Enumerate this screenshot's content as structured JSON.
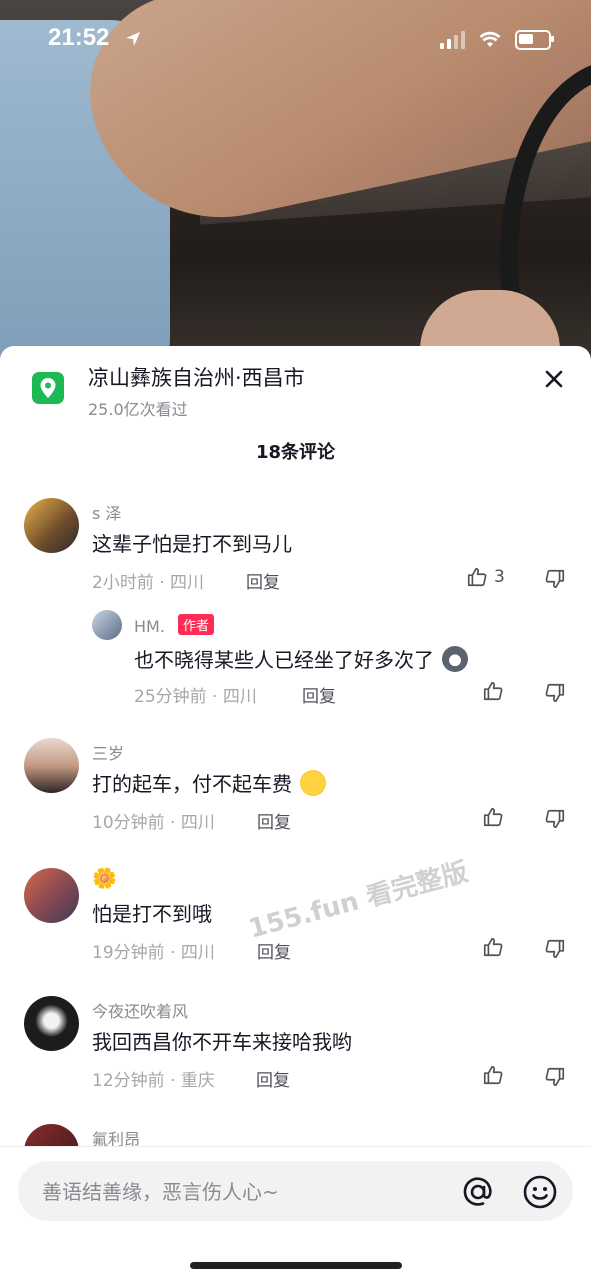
{
  "status_bar": {
    "time": "21:52"
  },
  "location": {
    "title": "凉山彝族自治州·西昌市",
    "views": "25.0亿次看过"
  },
  "comments_header": {
    "count_label": "18条评论"
  },
  "comments": [
    {
      "name": "s 泽",
      "text": "这辈子怕是打不到马儿",
      "meta": "2小时前 · 四川",
      "reply": "回复",
      "likes": "3"
    },
    {
      "name": "HM.",
      "author_tag": "作者",
      "text": "也不晓得某些人已经坐了好多次了",
      "meta": "25分钟前 · 四川",
      "reply": "回复"
    },
    {
      "name": "三岁",
      "text": "打的起车，付不起车费",
      "meta": "10分钟前 · 四川",
      "reply": "回复"
    },
    {
      "name": "🌼",
      "text": "怕是打不到哦",
      "meta": "19分钟前 · 四川",
      "reply": "回复"
    },
    {
      "name": "今夜还吹着风",
      "text": "我回西昌你不开车来接哈我哟",
      "meta": "12分钟前 · 重庆",
      "reply": "回复"
    },
    {
      "name": "氟利昂"
    }
  ],
  "watermark": "155.fun 看完整版",
  "input": {
    "placeholder": "善语结善缘，恶言伤人心~"
  },
  "colors": {
    "accent": "#fe2c55",
    "location_green": "#1db954",
    "text_primary": "#161823",
    "text_secondary": "#8a8b91"
  }
}
